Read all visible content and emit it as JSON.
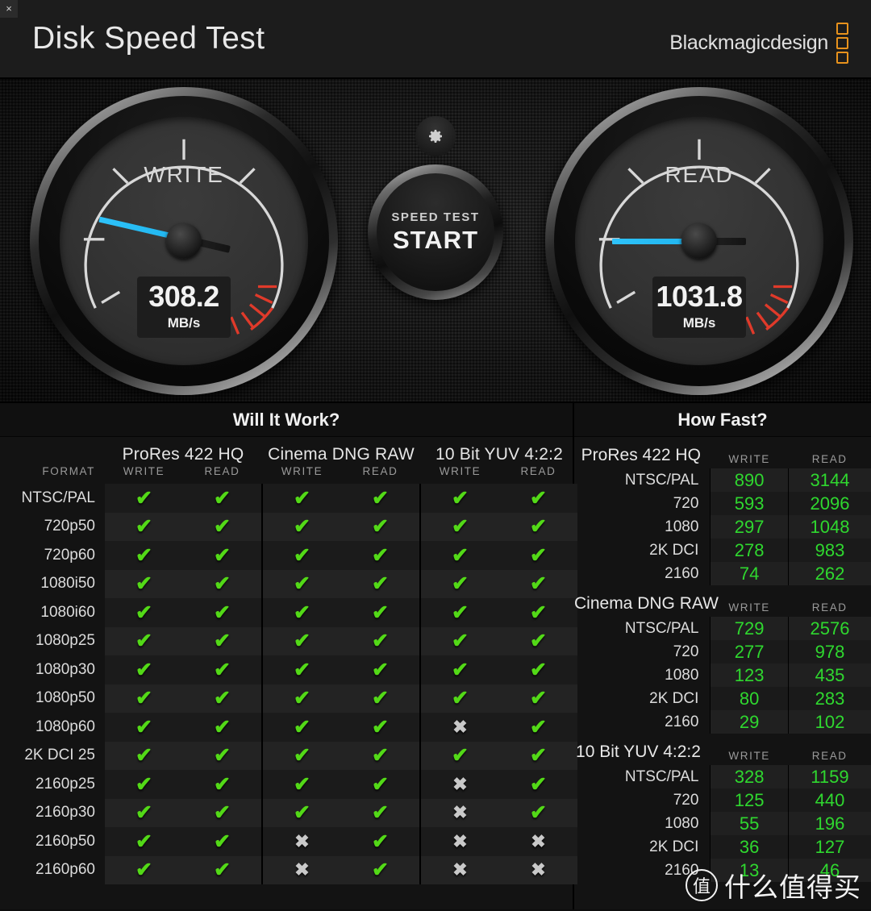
{
  "window": {
    "close_label": "×"
  },
  "header": {
    "title": "Disk Speed Test",
    "brand": "Blackmagicdesign"
  },
  "gauges": {
    "write": {
      "label": "WRITE",
      "value": "308.2",
      "unit": "MB/s",
      "needle_angle_deg": 193,
      "needle_color": "#27bcf4"
    },
    "read": {
      "label": "READ",
      "value": "1031.8",
      "unit": "MB/s",
      "needle_angle_deg": 180,
      "needle_color": "#27bcf4"
    }
  },
  "center": {
    "gear_icon": "gear-icon",
    "start_small": "SPEED TEST",
    "start_big": "START"
  },
  "will_it_work": {
    "title": "Will It Work?",
    "format_header": "FORMAT",
    "codecs": [
      {
        "name": "ProRes 422 HQ",
        "sub": [
          "WRITE",
          "READ"
        ]
      },
      {
        "name": "Cinema DNG RAW",
        "sub": [
          "WRITE",
          "READ"
        ]
      },
      {
        "name": "10 Bit YUV 4:2:2",
        "sub": [
          "WRITE",
          "READ"
        ]
      }
    ],
    "ok_glyph": "✔",
    "no_glyph": "✖",
    "rows": [
      {
        "format": "NTSC/PAL",
        "cells": [
          true,
          true,
          true,
          true,
          true,
          true
        ]
      },
      {
        "format": "720p50",
        "cells": [
          true,
          true,
          true,
          true,
          true,
          true
        ]
      },
      {
        "format": "720p60",
        "cells": [
          true,
          true,
          true,
          true,
          true,
          true
        ]
      },
      {
        "format": "1080i50",
        "cells": [
          true,
          true,
          true,
          true,
          true,
          true
        ]
      },
      {
        "format": "1080i60",
        "cells": [
          true,
          true,
          true,
          true,
          true,
          true
        ]
      },
      {
        "format": "1080p25",
        "cells": [
          true,
          true,
          true,
          true,
          true,
          true
        ]
      },
      {
        "format": "1080p30",
        "cells": [
          true,
          true,
          true,
          true,
          true,
          true
        ]
      },
      {
        "format": "1080p50",
        "cells": [
          true,
          true,
          true,
          true,
          true,
          true
        ]
      },
      {
        "format": "1080p60",
        "cells": [
          true,
          true,
          true,
          true,
          false,
          true
        ]
      },
      {
        "format": "2K DCI 25",
        "cells": [
          true,
          true,
          true,
          true,
          true,
          true
        ]
      },
      {
        "format": "2160p25",
        "cells": [
          true,
          true,
          true,
          true,
          false,
          true
        ]
      },
      {
        "format": "2160p30",
        "cells": [
          true,
          true,
          true,
          true,
          false,
          true
        ]
      },
      {
        "format": "2160p50",
        "cells": [
          true,
          true,
          false,
          true,
          false,
          false
        ]
      },
      {
        "format": "2160p60",
        "cells": [
          true,
          true,
          false,
          true,
          false,
          false
        ]
      }
    ]
  },
  "how_fast": {
    "title": "How Fast?",
    "write_header": "WRITE",
    "read_header": "READ",
    "groups": [
      {
        "name": "ProRes 422 HQ",
        "rows": [
          {
            "res": "NTSC/PAL",
            "write": "890",
            "read": "3144"
          },
          {
            "res": "720",
            "write": "593",
            "read": "2096"
          },
          {
            "res": "1080",
            "write": "297",
            "read": "1048"
          },
          {
            "res": "2K DCI",
            "write": "278",
            "read": "983"
          },
          {
            "res": "2160",
            "write": "74",
            "read": "262"
          }
        ]
      },
      {
        "name": "Cinema DNG RAW",
        "rows": [
          {
            "res": "NTSC/PAL",
            "write": "729",
            "read": "2576"
          },
          {
            "res": "720",
            "write": "277",
            "read": "978"
          },
          {
            "res": "1080",
            "write": "123",
            "read": "435"
          },
          {
            "res": "2K DCI",
            "write": "80",
            "read": "283"
          },
          {
            "res": "2160",
            "write": "29",
            "read": "102"
          }
        ]
      },
      {
        "name": "10 Bit YUV 4:2:2",
        "rows": [
          {
            "res": "NTSC/PAL",
            "write": "328",
            "read": "1159"
          },
          {
            "res": "720",
            "write": "125",
            "read": "440"
          },
          {
            "res": "1080",
            "write": "55",
            "read": "196"
          },
          {
            "res": "2K DCI",
            "write": "36",
            "read": "127"
          },
          {
            "res": "2160",
            "write": "13",
            "read": "46"
          }
        ]
      }
    ]
  },
  "watermark": {
    "badge": "值",
    "text": "什么值得买"
  },
  "colors": {
    "accent_brand": "#e8921c",
    "needle": "#27bcf4",
    "ok_green": "#53d917",
    "value_green": "#2fd82f",
    "redzone": "#e03a2a"
  }
}
